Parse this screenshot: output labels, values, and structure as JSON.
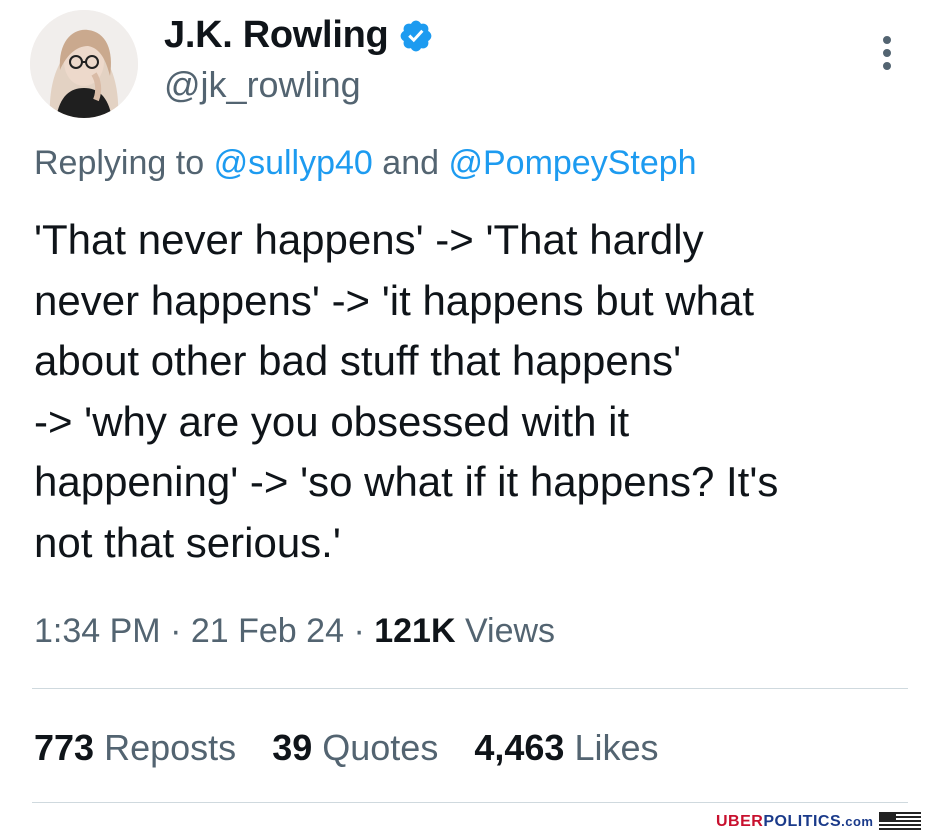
{
  "tweet": {
    "author": {
      "display_name": "J.K. Rowling",
      "handle": "@jk_rowling",
      "verified": true,
      "verified_color": "#1d9bf0"
    },
    "reply_context": {
      "prefix": "Replying to",
      "mention_1": "@sullyp40",
      "joiner": "and",
      "mention_2": "@PompeySteph"
    },
    "text": "'That never happens' -> 'That hardly\nnever happens' -> 'it happens but what\nabout other bad stuff that happens'\n-> 'why are you obsessed with it\nhappening' -> 'so what if it happens? It's\nnot that serious.'",
    "meta": {
      "time": "1:34 PM",
      "date": "21 Feb 24",
      "views_count": "121K",
      "views_label": "Views"
    },
    "stats": {
      "reposts_count": "773",
      "reposts_label": "Reposts",
      "quotes_count": "39",
      "quotes_label": "Quotes",
      "likes_count": "4,463",
      "likes_label": "Likes"
    }
  },
  "watermark": {
    "part_1": "UBER",
    "part_2": "POLITICS",
    "part_3": ".com"
  },
  "icons": {
    "verified": "verified-badge-icon",
    "more": "more-vertical-icon",
    "flag": "us-flag-icon"
  },
  "colors": {
    "text": "#0f1419",
    "secondary": "#536471",
    "link": "#1d9bf0",
    "divider": "#cfd9de"
  }
}
